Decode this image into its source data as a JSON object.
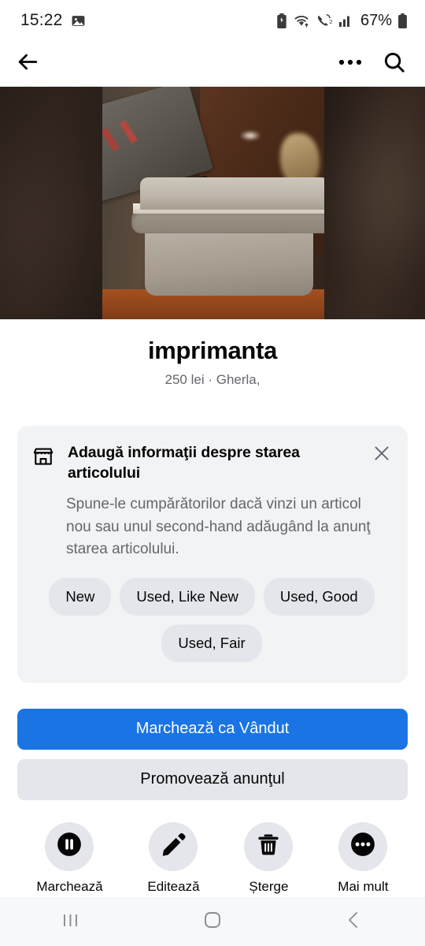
{
  "statusbar": {
    "time": "15:22",
    "battery_percent": "67%",
    "icons": [
      "image-icon",
      "battery-saver-icon",
      "wifi-icon",
      "call-icon",
      "signal-icon",
      "battery-icon"
    ]
  },
  "appbar": {
    "back_icon": "arrow-left-icon",
    "more_icon": "more-horizontal-icon",
    "search_icon": "search-icon"
  },
  "listing": {
    "title": "imprimanta",
    "subtitle": "250 lei · Gherla,",
    "photo_alt": "printer on wooden floor"
  },
  "condition_card": {
    "icon": "storefront-icon",
    "close_icon": "close-icon",
    "title": "Adaugă informaţii despre starea articolului",
    "body": "Spune-le cumpărătorilor dacă vinzi un articol nou sau unul second-hand adăugând la anunţ starea articolului.",
    "chips": [
      {
        "label": "New"
      },
      {
        "label": "Used, Like New"
      },
      {
        "label": "Used, Good"
      },
      {
        "label": "Used, Fair"
      }
    ]
  },
  "primary_actions": {
    "mark_sold": "Marchează ca Vândut",
    "promote": "Promovează anunţul",
    "primary_color": "#1b74e4"
  },
  "quick_actions": [
    {
      "label": "Marchează",
      "icon": "pause-circle-icon"
    },
    {
      "label": "Editează",
      "icon": "pencil-icon"
    },
    {
      "label": "Șterge",
      "icon": "trash-icon"
    },
    {
      "label": "Mai mult",
      "icon": "more-circle-icon"
    }
  ],
  "navbar": {
    "recents_icon": "recents-icon",
    "home_icon": "home-icon",
    "back_icon": "chevron-back-icon"
  }
}
